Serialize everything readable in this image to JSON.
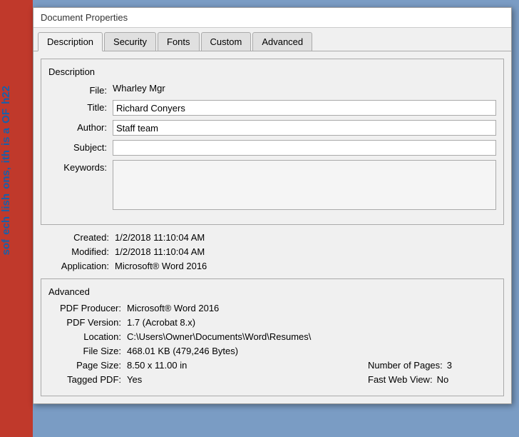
{
  "window": {
    "title": "Document Properties"
  },
  "tabs": [
    {
      "id": "description",
      "label": "Description",
      "active": true
    },
    {
      "id": "security",
      "label": "Security",
      "active": false
    },
    {
      "id": "fonts",
      "label": "Fonts",
      "active": false
    },
    {
      "id": "custom",
      "label": "Custom",
      "active": false
    },
    {
      "id": "advanced",
      "label": "Advanced",
      "active": false
    }
  ],
  "description_section": {
    "title": "Description",
    "fields": {
      "file_label": "File:",
      "file_value": "Wharley Mgr",
      "title_label": "Title:",
      "title_value": "Richard Conyers",
      "author_label": "Author:",
      "author_value": "Staff team",
      "subject_label": "Subject:",
      "subject_value": "",
      "keywords_label": "Keywords:",
      "keywords_value": ""
    }
  },
  "metadata": {
    "created_label": "Created:",
    "created_value": "1/2/2018 11:10:04 AM",
    "modified_label": "Modified:",
    "modified_value": "1/2/2018 11:10:04 AM",
    "application_label": "Application:",
    "application_value": "Microsoft® Word 2016"
  },
  "advanced_section": {
    "title": "Advanced",
    "pdf_producer_label": "PDF Producer:",
    "pdf_producer_value": "Microsoft® Word 2016",
    "pdf_version_label": "PDF Version:",
    "pdf_version_value": "1.7 (Acrobat 8.x)",
    "location_label": "Location:",
    "location_value": "C:\\Users\\Owner\\Documents\\Word\\Resumes\\",
    "file_size_label": "File Size:",
    "file_size_value": "468.01 KB (479,246 Bytes)",
    "page_size_label": "Page Size:",
    "page_size_value": "8.50 x 11.00 in",
    "num_pages_label": "Number of Pages:",
    "num_pages_value": "3",
    "tagged_pdf_label": "Tagged PDF:",
    "tagged_pdf_value": "Yes",
    "fast_web_label": "Fast Web View:",
    "fast_web_value": "No"
  },
  "left_sidebar": {
    "text1": "h22",
    "text2": "OF",
    "text3": "is a",
    "text4": "ith",
    "text5": "ons,",
    "text6": "lish",
    "text7": "ech",
    "text8": "sof"
  }
}
